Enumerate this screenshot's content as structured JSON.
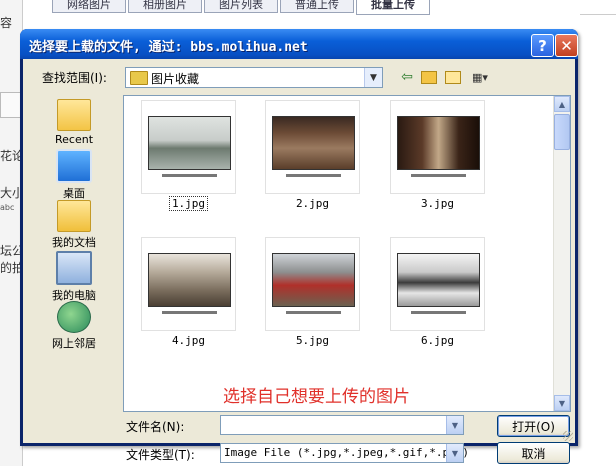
{
  "background": {
    "tabs": [
      "网络图片",
      "相册图片",
      "图片列表",
      "普通上传",
      "批量上传"
    ],
    "active_tab": 4,
    "left_texts": [
      "容",
      "花论",
      "大小",
      "abc",
      "坛公",
      "的拍"
    ]
  },
  "dialog": {
    "title": "选择要上载的文件, 通过: bbs.molihua.net",
    "help_label": "?",
    "close_label": "✕",
    "lookin_label": "查找范围(I):",
    "lookin_value": "图片收藏",
    "places": [
      {
        "label": "Recent",
        "icon": "recent-folder-icon"
      },
      {
        "label": "桌面",
        "icon": "desktop-icon"
      },
      {
        "label": "我的文档",
        "icon": "my-documents-icon"
      },
      {
        "label": "我的电脑",
        "icon": "my-computer-icon"
      },
      {
        "label": "网上邻居",
        "icon": "network-places-icon"
      }
    ],
    "files": [
      {
        "name": "1.jpg",
        "selected": true
      },
      {
        "name": "2.jpg",
        "selected": false
      },
      {
        "name": "3.jpg",
        "selected": false
      },
      {
        "name": "4.jpg",
        "selected": false
      },
      {
        "name": "5.jpg",
        "selected": false
      },
      {
        "name": "6.jpg",
        "selected": false
      }
    ],
    "annotation": "选择自己想要上传的图片",
    "filename_label": "文件名(N):",
    "filename_value": "",
    "filetype_label": "文件类型(T):",
    "filetype_value": "Image File (*.jpg,*.jpeg,*.gif,*.png)",
    "open_button": "打开(O)",
    "cancel_button": "取消"
  }
}
